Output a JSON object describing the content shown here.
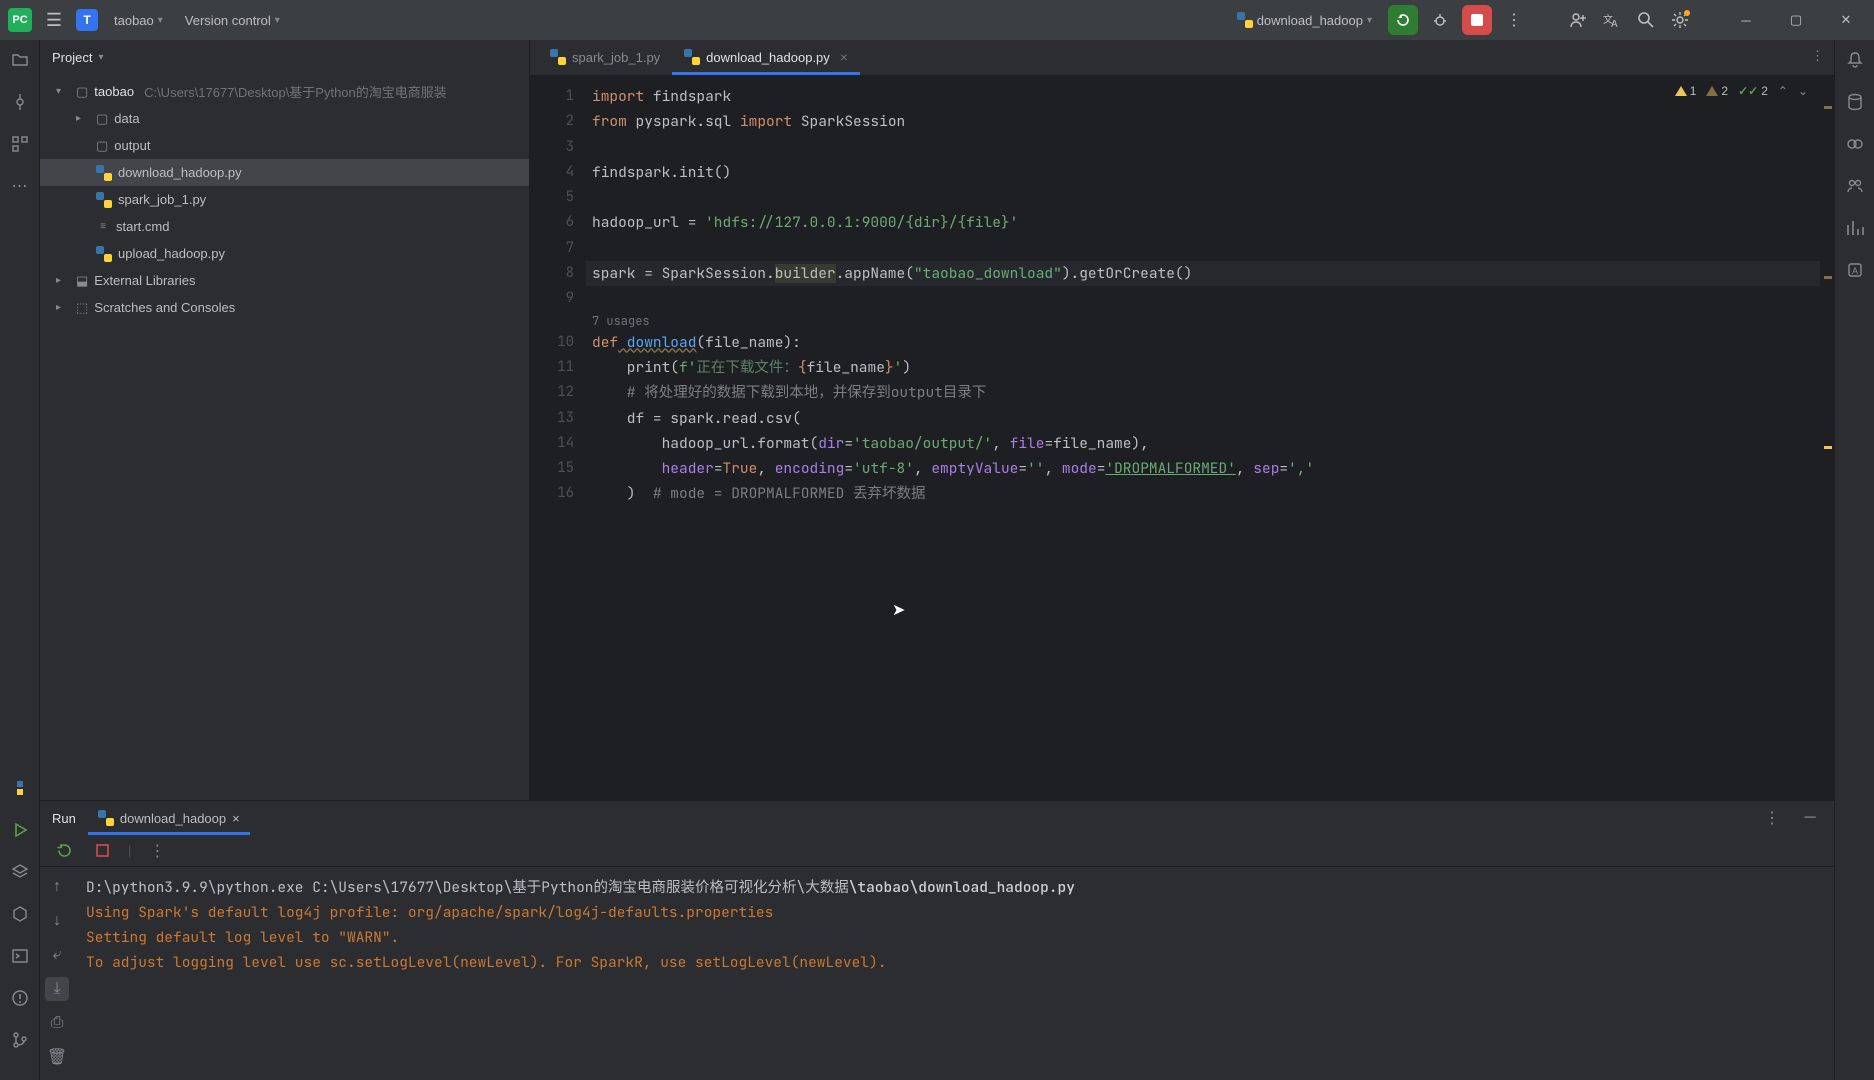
{
  "titlebar": {
    "project": "taobao",
    "vcs": "Version control",
    "run_config": "download_hadoop"
  },
  "project_panel": {
    "title": "Project",
    "root": {
      "name": "taobao",
      "path": "C:\\Users\\17677\\Desktop\\基于Python的淘宝电商服装"
    },
    "folders": {
      "data": "data",
      "output": "output"
    },
    "files": {
      "download_hadoop": "download_hadoop.py",
      "spark_job_1": "spark_job_1.py",
      "start_cmd": "start.cmd",
      "upload_hadoop": "upload_hadoop.py"
    },
    "external": "External Libraries",
    "scratches": "Scratches and Consoles"
  },
  "editor": {
    "tabs": {
      "spark_job_1": "spark_job_1.py",
      "download_hadoop": "download_hadoop.py"
    },
    "inspections": {
      "warn_weak": "1",
      "warn": "2",
      "ok": "2"
    },
    "usages": "7 usages",
    "code": {
      "l1a": "import",
      "l1b": " findspark",
      "l2a": "from",
      "l2b": " pyspark.sql ",
      "l2c": "import",
      "l2d": " SparkSession",
      "l4": "findspark.init()",
      "l6a": "hadoop_url = ",
      "l6b": "'hdfs://127.0.0.1:9000/{dir}/{file}'",
      "l8a": "spark = SparkSession.",
      "l8b": "builder",
      "l8c": ".appName(",
      "l8d": "\"taobao_download\"",
      "l8e": ").getOrCreate()",
      "l10a": "def",
      "l10b": " download",
      "l10c": "(file_name):",
      "l11a": "    print(",
      "l11b": "f'",
      "l11c": "正在下载文件：",
      "l11d": "{",
      "l11e": "file_name",
      "l11f": "}",
      "l11g": "'",
      ")": ")",
      "l12": "    # 将处理好的数据下载到本地，并保存到output目录下",
      "l13": "    df = spark.read.csv(",
      "l14a": "        hadoop_url.format(",
      "l14b": "dir",
      "l14c": "=",
      "l14d": "'taobao/output/'",
      "l14e": ", ",
      "l14f": "file",
      "l14g": "=file_name),",
      "l15a": "        ",
      "l15b": "header",
      "l15c": "=",
      "l15d": "True",
      "l15e": ", ",
      "l15f": "encoding",
      "l15g": "=",
      "l15h": "'utf-8'",
      "l15i": ", ",
      "l15j": "emptyValue",
      "l15k": "=",
      "l15l": "''",
      "l15m": ", ",
      "l15n": "mode",
      "l15o": "=",
      "l15p": "'DROPMALFORMED'",
      "l15q": ", ",
      "l15r": "sep",
      "l15s": "=",
      "l15t": "','",
      "l16a": "    )  ",
      "l16b": "# mode = DROPMALFORMED 丢弃坏数据"
    },
    "line_numbers": [
      "1",
      "2",
      "3",
      "4",
      "5",
      "6",
      "7",
      "8",
      "9",
      "10",
      "11",
      "12",
      "13",
      "14",
      "15",
      "16"
    ]
  },
  "run": {
    "title": "Run",
    "tab": "download_hadoop",
    "console": {
      "l1a": "D:\\python3.9.9\\python.exe C:\\Users\\17677\\Desktop\\基于Python的淘宝电商服装价格可视化分析\\大数据",
      "l1b": "\\taobao\\download_hadoop.py",
      "l2": "Using Spark's default log4j profile: org/apache/spark/log4j-defaults.properties",
      "l3": "Setting default log level to \"WARN\".",
      "l4": "To adjust logging level use sc.setLogLevel(newLevel). For SparkR, use setLogLevel(newLevel)."
    }
  }
}
